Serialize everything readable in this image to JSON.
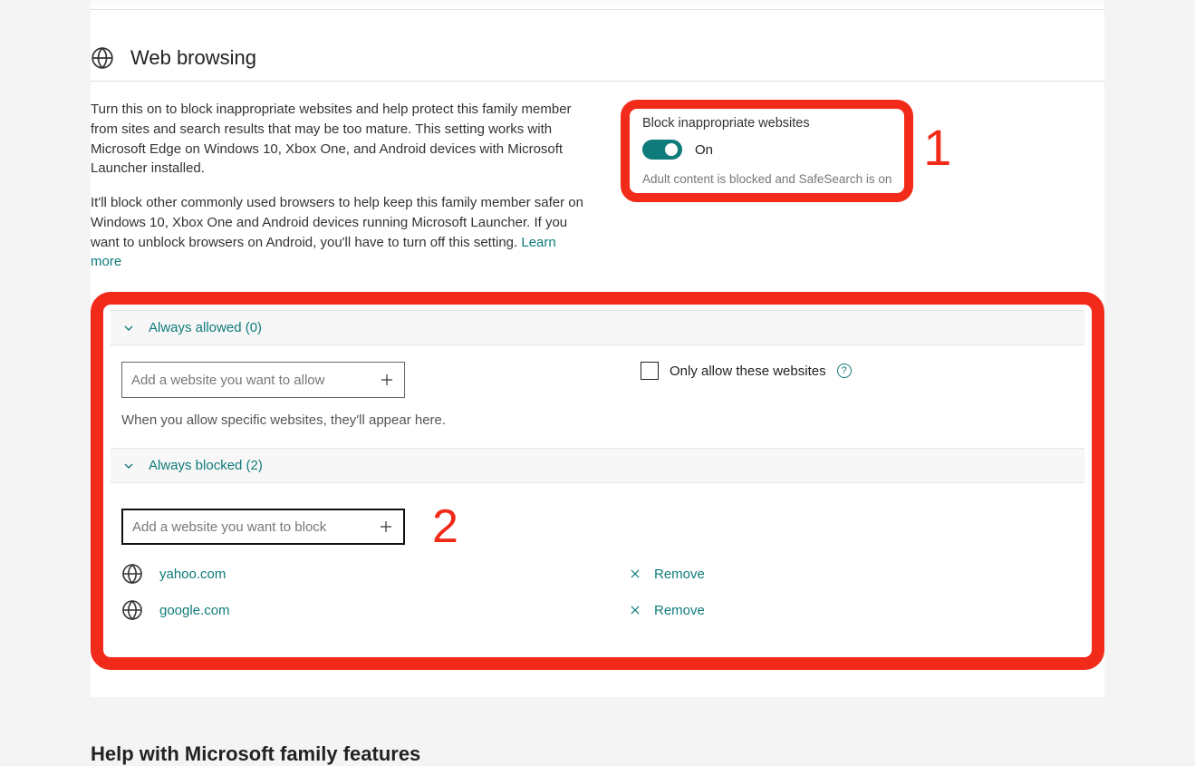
{
  "section": {
    "title": "Web browsing",
    "desc1": "Turn this on to block inappropriate websites and help protect this family member from sites and search results that may be too mature. This setting works with Microsoft Edge on Windows 10, Xbox One, and Android devices with Microsoft Launcher installed.",
    "desc2_pre": "It'll block other commonly used browsers to help keep this family member safer on Windows 10, Xbox One and Android devices running Microsoft Launcher. If you want to unblock browsers on Android, you'll have to turn off this setting. ",
    "learn_more": "Learn more"
  },
  "toggle_card": {
    "title": "Block inappropriate websites",
    "state_label": "On",
    "subtext": "Adult content is blocked and SafeSearch is on"
  },
  "annotations": {
    "label1": "1",
    "label2": "2"
  },
  "allowed": {
    "header": "Always allowed (0)",
    "placeholder": "Add a website you want to allow",
    "hint": "When you allow specific websites, they'll appear here.",
    "only_allow_label": "Only allow these websites"
  },
  "blocked": {
    "header": "Always blocked (2)",
    "placeholder": "Add a website you want to block",
    "remove_label": "Remove",
    "sites": [
      "yahoo.com",
      "google.com"
    ]
  },
  "help_heading": "Help with Microsoft family features"
}
